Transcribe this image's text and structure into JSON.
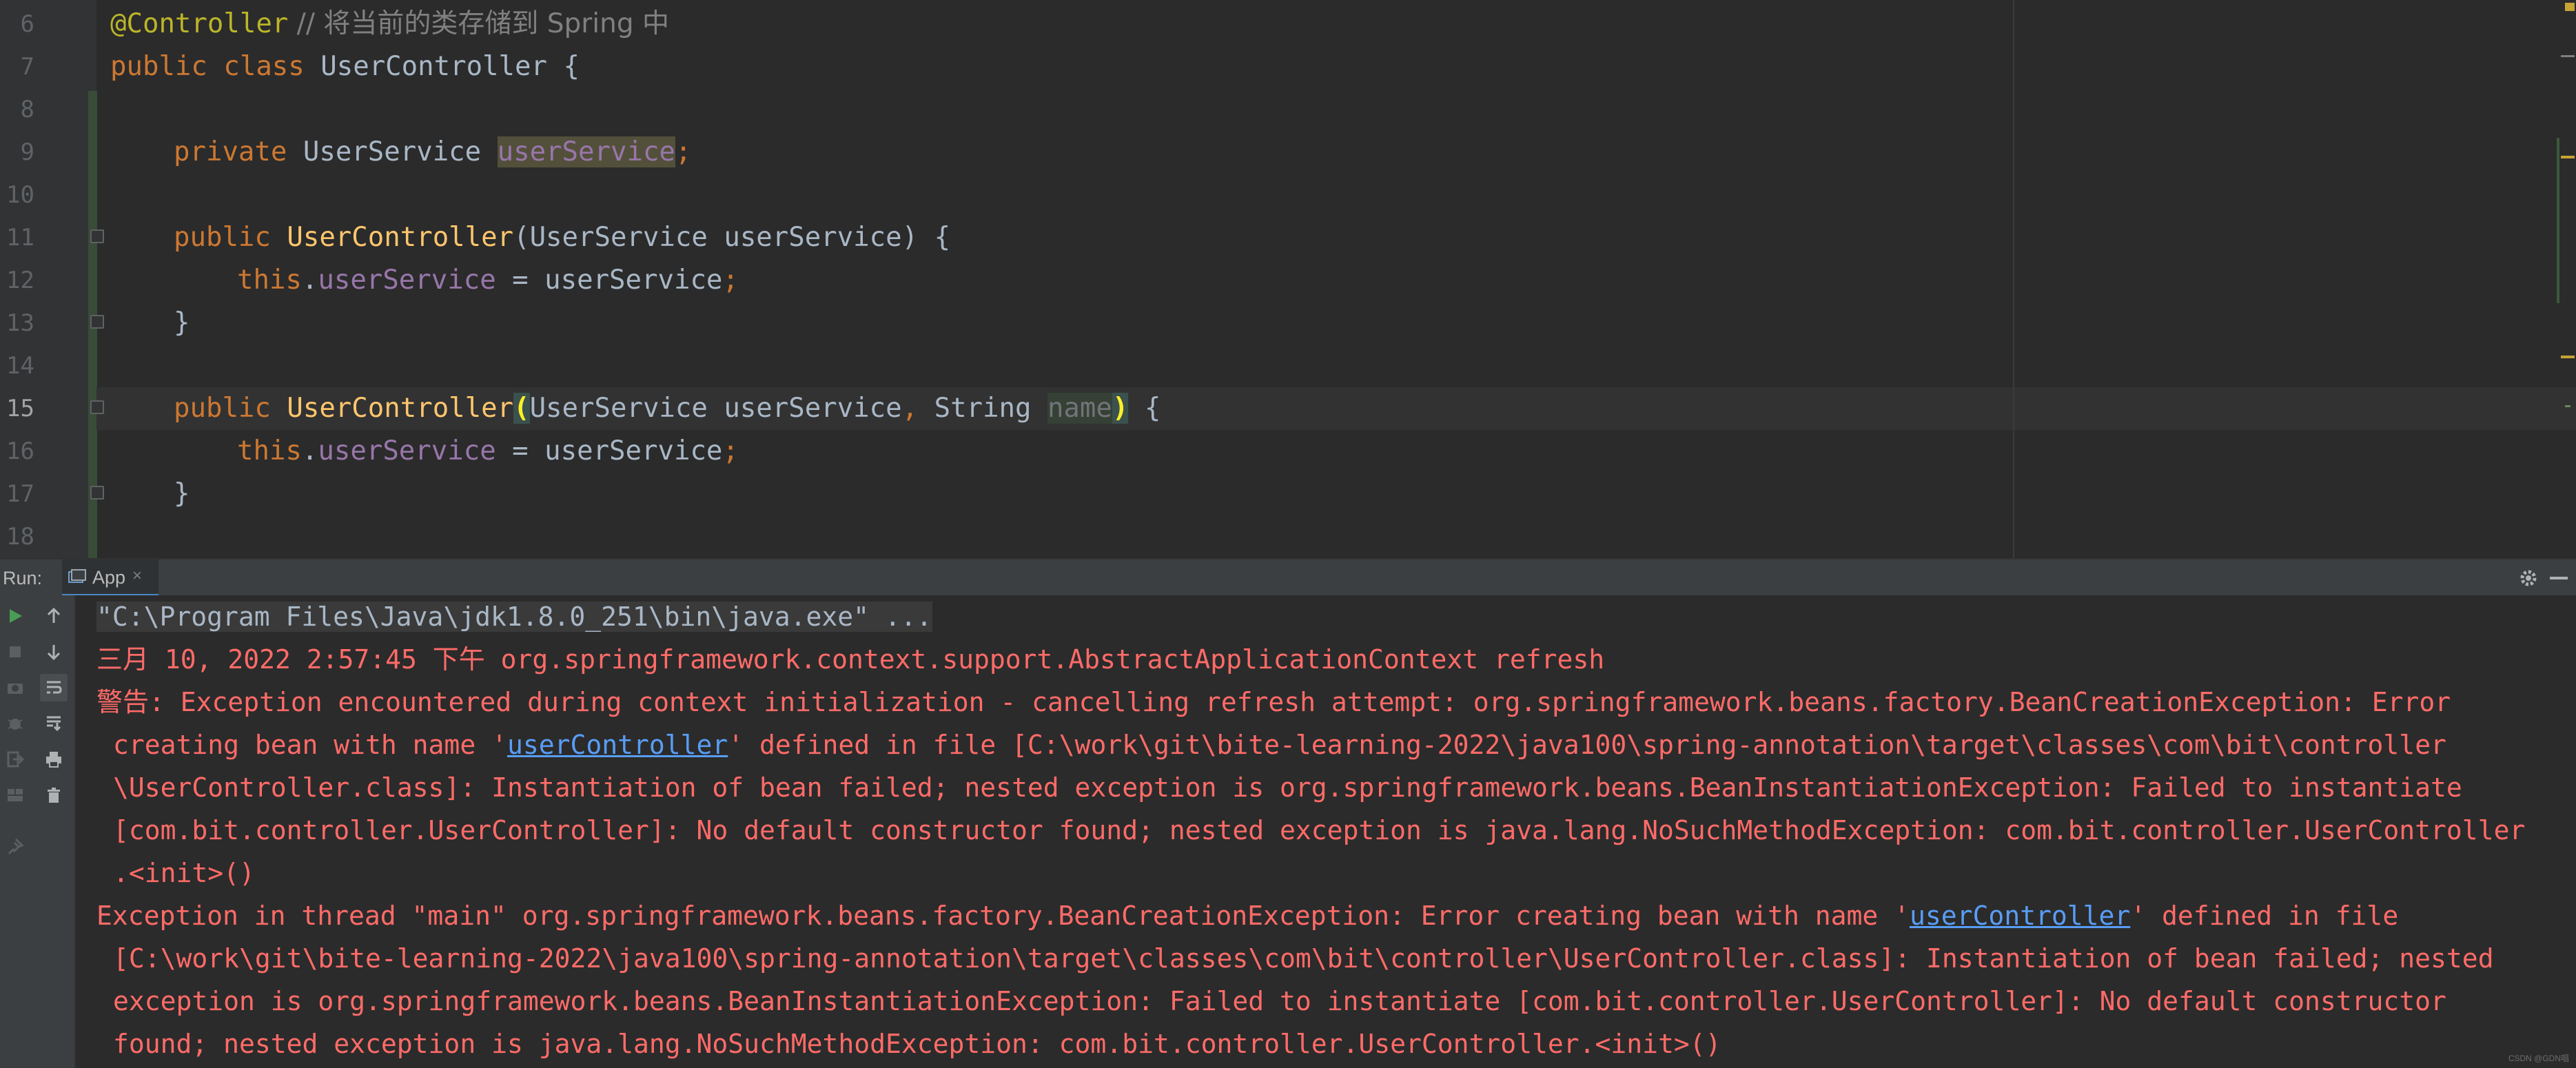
{
  "editor": {
    "line_numbers": [
      "6",
      "7",
      "8",
      "9",
      "10",
      "11",
      "12",
      "13",
      "14",
      "15",
      "16",
      "17",
      "18"
    ],
    "current_line": "15",
    "code": {
      "l6_annotation": "@Controller",
      "l6_comment": " // 将当前的类存储到 Spring 中",
      "l7_kw1": "public",
      "l7_kw2": " class",
      "l7_rest": " UserController {",
      "l9_kw": "private",
      "l9_type": " UserService ",
      "l9_field": "userService",
      "l9_semi": ";",
      "l11_kw": "public",
      "l11_fn": " UserController",
      "l11_rest": "(UserService userService) {",
      "l12_this": "this",
      "l12_dot": ".",
      "l12_field": "userService",
      "l12_rest": " = userService",
      "l12_semi": ";",
      "l13_brace": "}",
      "l15_kw": "public",
      "l15_fn": " UserController",
      "l15_open": "(",
      "l15_type1": "UserService userService",
      "l15_comma": ",",
      "l15_type2": " String ",
      "l15_param": "name",
      "l15_close": ")",
      "l15_rest": " {",
      "l16_this": "this",
      "l16_dot": ".",
      "l16_field": "userService",
      "l16_rest": " = userService",
      "l16_semi": ";",
      "l17_brace": "}"
    }
  },
  "run_panel": {
    "label": "Run:",
    "tab_label": "App",
    "tab_close": "×",
    "console": {
      "cmd": "\"C:\\Program Files\\Java\\jdk1.8.0_251\\bin\\java.exe\" ...",
      "log_line": "三月 10, 2022 2:57:45 下午 org.springframework.context.support.AbstractApplicationContext refresh",
      "warn_1": "警告: Exception encountered during context initialization - cancelling refresh attempt: org.springframework.beans.factory.BeanCreationException: Error",
      "warn_2_pre": "creating bean with name '",
      "warn_2_link": "userController",
      "warn_2_post": "' defined in file [C:\\work\\git\\bite-learning-2022\\java100\\spring-annotation\\target\\classes\\com\\bit\\controller",
      "warn_3": "\\UserController.class]: Instantiation of bean failed; nested exception is org.springframework.beans.BeanInstantiationException: Failed to instantiate",
      "warn_4": "[com.bit.controller.UserController]: No default constructor found; nested exception is java.lang.NoSuchMethodException: com.bit.controller.UserController",
      "warn_5": ".<init>()",
      "exc_1_pre": "Exception in thread \"main\" org.springframework.beans.factory.BeanCreationException: Error creating bean with name '",
      "exc_1_link": "userController",
      "exc_1_post": "' defined in file",
      "exc_2": "[C:\\work\\git\\bite-learning-2022\\java100\\spring-annotation\\target\\classes\\com\\bit\\controller\\UserController.class]: Instantiation of bean failed; nested",
      "exc_3": "exception is org.springframework.beans.BeanInstantiationException: Failed to instantiate [com.bit.controller.UserController]: No default constructor",
      "exc_4": "found; nested exception is java.lang.NoSuchMethodException: com.bit.controller.UserController.<init>()"
    },
    "toolbar_icons": [
      "rerun-icon",
      "stop-icon",
      "scroll-up-icon",
      "scroll-down-icon",
      "camera-icon",
      "soft-wrap-icon",
      "debug-icon",
      "scroll-to-end-icon",
      "exit-icon",
      "print-icon",
      "layout-icon",
      "clear-icon",
      "pin-icon"
    ]
  },
  "watermark": "CSDN @GDN唱",
  "colors": {
    "background": "#2b2b2b",
    "keyword": "#cc7832",
    "annotation": "#bbb529",
    "method": "#ffc66d",
    "field": "#9876aa",
    "error_text": "#ff6b68",
    "link": "#589df6"
  }
}
